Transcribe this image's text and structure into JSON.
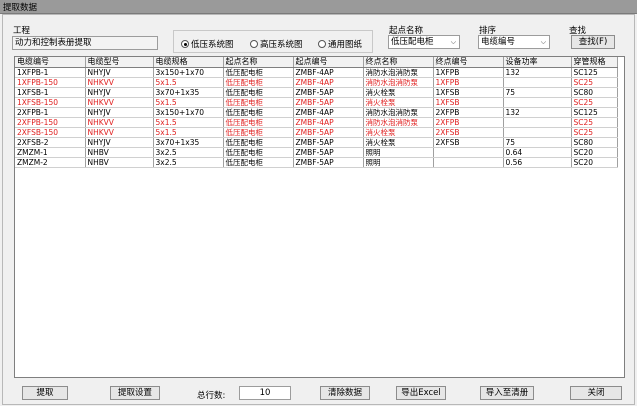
{
  "window": {
    "title": "提取数据"
  },
  "project": {
    "label": "工程",
    "value": "动力和控制表册提取"
  },
  "system_type": {
    "options": [
      {
        "label": "低压系统图",
        "selected": true
      },
      {
        "label": "高压系统图",
        "selected": false
      },
      {
        "label": "通用图纸",
        "selected": false
      }
    ]
  },
  "start_name": {
    "label": "起点名称",
    "value": "低压配电柜"
  },
  "sort": {
    "label": "排序",
    "value": "电缆编号"
  },
  "search": {
    "label": "查找",
    "button_label": "查找(F)"
  },
  "table": {
    "columns": [
      "电缆编号",
      "电缆型号",
      "电缆规格",
      "起点名称",
      "起点编号",
      "终点名称",
      "终点编号",
      "设备功率",
      "穿管规格"
    ],
    "rows": [
      {
        "red": false,
        "cells": [
          "1XFPB-1",
          "NHYJV",
          "3x150+1x70",
          "低压配电柜",
          "ZMBF-4AP",
          "消防水泡消防泵",
          "1XFPB",
          "132",
          "SC125"
        ]
      },
      {
        "red": true,
        "cells": [
          "1XFPB-150",
          "NHKVV",
          "5x1.5",
          "低压配电柜",
          "ZMBF-4AP",
          "消防水泡消防泵",
          "1XFPB",
          "",
          "SC25"
        ]
      },
      {
        "red": false,
        "cells": [
          "1XFSB-1",
          "NHYJV",
          "3x70+1x35",
          "低压配电柜",
          "ZMBF-5AP",
          "消火栓泵",
          "1XFSB",
          "75",
          "SC80"
        ]
      },
      {
        "red": true,
        "cells": [
          "1XFSB-150",
          "NHKVV",
          "5x1.5",
          "低压配电柜",
          "ZMBF-5AP",
          "消火栓泵",
          "1XFSB",
          "",
          "SC25"
        ]
      },
      {
        "red": false,
        "cells": [
          "2XFPB-1",
          "NHYJV",
          "3x150+1x70",
          "低压配电柜",
          "ZMBF-4AP",
          "消防水泡消防泵",
          "2XFPB",
          "132",
          "SC125"
        ]
      },
      {
        "red": true,
        "cells": [
          "2XFPB-150",
          "NHKVV",
          "5x1.5",
          "低压配电柜",
          "ZMBF-4AP",
          "消防水泡消防泵",
          "2XFPB",
          "",
          "SC25"
        ]
      },
      {
        "red": true,
        "cells": [
          "2XFSB-150",
          "NHKVV",
          "5x1.5",
          "低压配电柜",
          "ZMBF-5AP",
          "消火栓泵",
          "2XFSB",
          "",
          "SC25"
        ]
      },
      {
        "red": false,
        "cells": [
          "2XFSB-2",
          "NHYJV",
          "3x70+1x35",
          "低压配电柜",
          "ZMBF-5AP",
          "消火栓泵",
          "2XFSB",
          "75",
          "SC80"
        ]
      },
      {
        "red": false,
        "cells": [
          "ZMZM-1",
          "NHBV",
          "3x2.5",
          "低压配电柜",
          "ZMBF-5AP",
          "照明",
          "",
          "0.64",
          "SC20"
        ]
      },
      {
        "red": false,
        "cells": [
          "ZMZM-2",
          "NHBV",
          "3x2.5",
          "低压配电柜",
          "ZMBF-5AP",
          "照明",
          "",
          "0.56",
          "SC20"
        ]
      }
    ]
  },
  "footer": {
    "extract_label": "提取",
    "extract_settings_label": "提取设置",
    "total_rows_label": "总行数:",
    "total_rows_value": "10",
    "clear_label": "清除数据",
    "export_excel_label": "导出Excel",
    "import_label": "导入至清册",
    "close_label": "关闭"
  },
  "colors": {
    "red_row_text": "#e02020",
    "titlebar": "#9a9a9a"
  }
}
